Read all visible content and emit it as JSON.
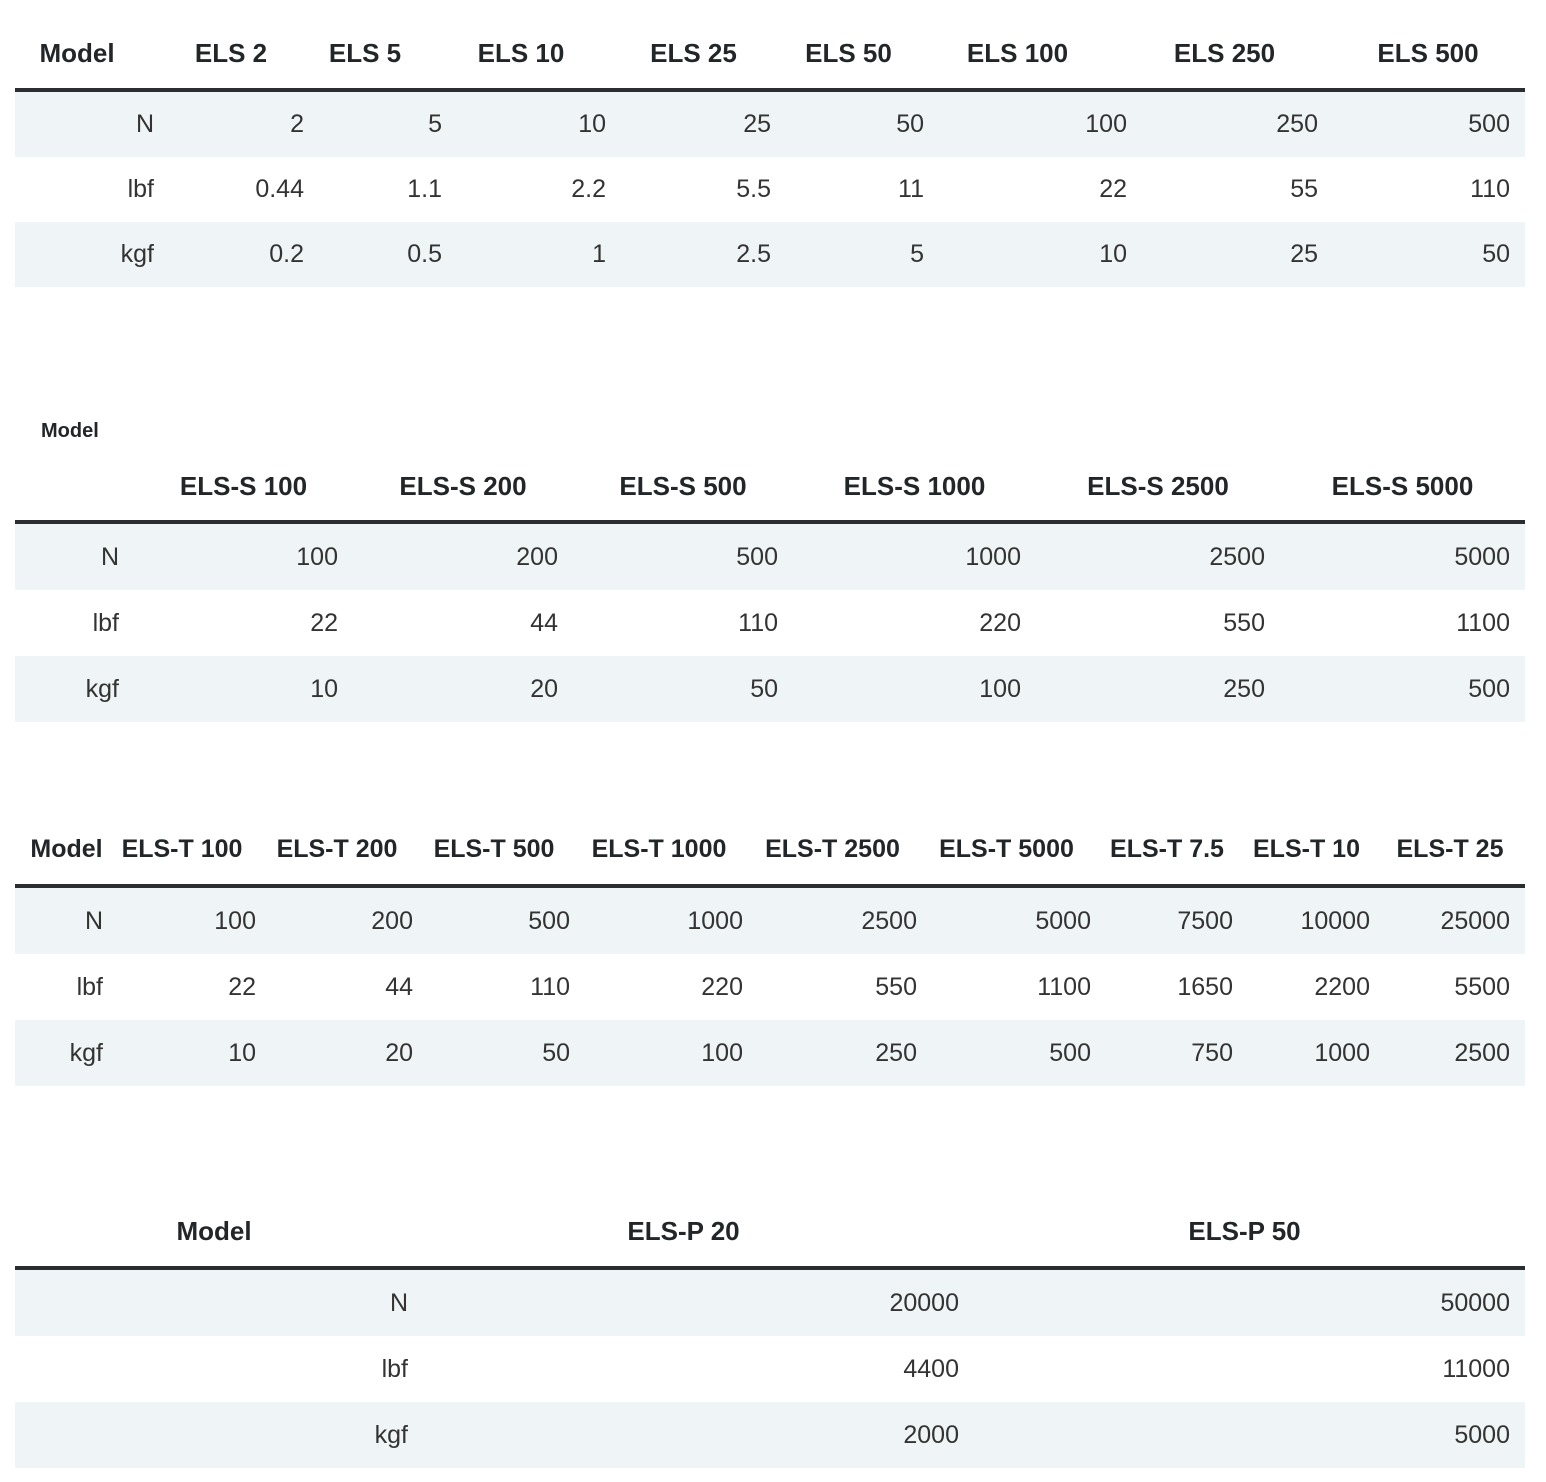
{
  "tables": [
    {
      "model_label": "Model",
      "columns": [
        "ELS 2",
        "ELS 5",
        "ELS 10",
        "ELS 25",
        "ELS 50",
        "ELS 100",
        "ELS 250",
        "ELS 500"
      ],
      "rows": [
        {
          "unit": "N",
          "values": [
            "2",
            "5",
            "10",
            "25",
            "50",
            "100",
            "250",
            "500"
          ]
        },
        {
          "unit": "lbf",
          "values": [
            "0.44",
            "1.1",
            "2.2",
            "5.5",
            "11",
            "22",
            "55",
            "110"
          ]
        },
        {
          "unit": "kgf",
          "values": [
            "0.2",
            "0.5",
            "1",
            "2.5",
            "5",
            "10",
            "25",
            "50"
          ]
        }
      ]
    },
    {
      "model_label": "Model",
      "columns": [
        "ELS-S 100",
        "ELS-S 200",
        "ELS-S 500",
        "ELS-S 1000",
        "ELS-S 2500",
        "ELS-S 5000"
      ],
      "rows": [
        {
          "unit": "N",
          "values": [
            "100",
            "200",
            "500",
            "1000",
            "2500",
            "5000"
          ]
        },
        {
          "unit": "lbf",
          "values": [
            "22",
            "44",
            "110",
            "220",
            "550",
            "1100"
          ]
        },
        {
          "unit": "kgf",
          "values": [
            "10",
            "20",
            "50",
            "100",
            "250",
            "500"
          ]
        }
      ]
    },
    {
      "model_label": "Model",
      "columns": [
        "ELS-T 100",
        "ELS-T 200",
        "ELS-T 500",
        "ELS-T 1000",
        "ELS-T 2500",
        "ELS-T 5000",
        "ELS-T 7.5",
        "ELS-T 10",
        "ELS-T 25"
      ],
      "rows": [
        {
          "unit": "N",
          "values": [
            "100",
            "200",
            "500",
            "1000",
            "2500",
            "5000",
            "7500",
            "10000",
            "25000"
          ]
        },
        {
          "unit": "lbf",
          "values": [
            "22",
            "44",
            "110",
            "220",
            "550",
            "1100",
            "1650",
            "2200",
            "5500"
          ]
        },
        {
          "unit": "kgf",
          "values": [
            "10",
            "20",
            "50",
            "100",
            "250",
            "500",
            "750",
            "1000",
            "2500"
          ]
        }
      ]
    },
    {
      "model_label": "Model",
      "columns": [
        "ELS-P 20",
        "ELS-P 50"
      ],
      "rows": [
        {
          "unit": "N",
          "values": [
            "20000",
            "50000"
          ]
        },
        {
          "unit": "lbf",
          "values": [
            "4400",
            "11000"
          ]
        },
        {
          "unit": "kgf",
          "values": [
            "2000",
            "5000"
          ]
        }
      ]
    }
  ],
  "colors": {
    "stripe": "#eff4f6",
    "header_rule": "#2b2e30",
    "text": "#333333"
  }
}
